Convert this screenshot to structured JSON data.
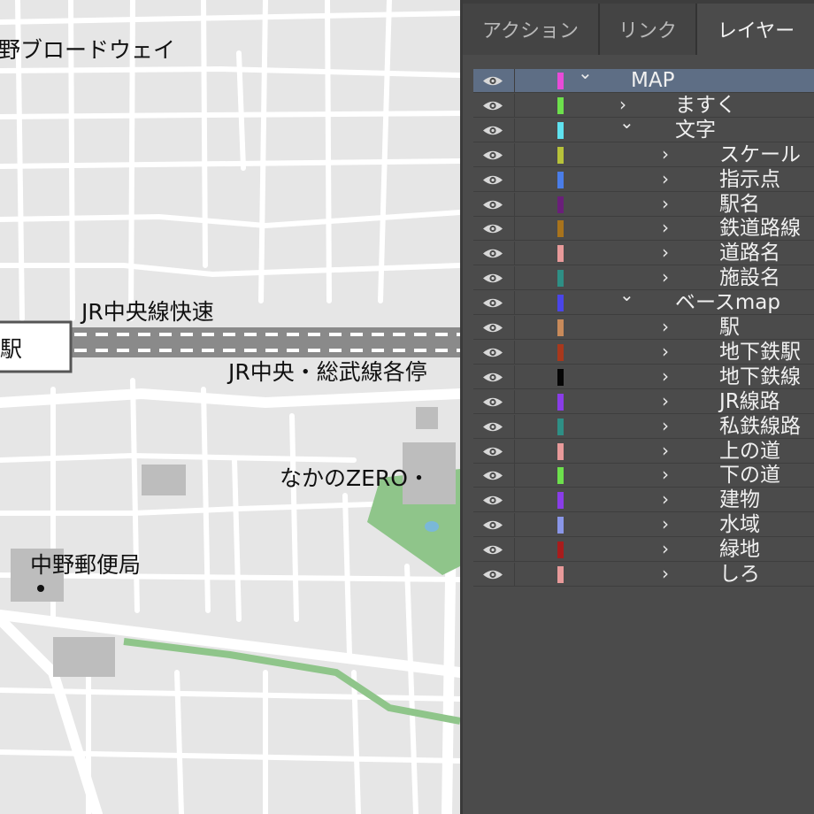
{
  "map": {
    "labels": {
      "broadway": "野ブロードウェイ",
      "jr_rapid": "JR中央線快速",
      "station": "駅",
      "jr_local": "JR中央・総武線各停",
      "nakano_zero": "なかのZERO・",
      "post_office": "中野郵便局"
    },
    "colors": {
      "road": "#ffffff",
      "block": "#efefef",
      "building": "#bdbdbd",
      "green": "#8fc58a",
      "water": "#7ab8d8",
      "rail_dark": "#7a7a7a"
    }
  },
  "panel": {
    "tabs": [
      {
        "label": "アクション",
        "active": false
      },
      {
        "label": "リンク",
        "active": false
      },
      {
        "label": "レイヤー",
        "active": true
      }
    ],
    "layers": [
      {
        "name": "MAP",
        "color": "#e84bd8",
        "expanded": true,
        "selected": true,
        "depth": 0
      },
      {
        "name": "ますく",
        "color": "#6de04c",
        "expanded": false,
        "depth": 1
      },
      {
        "name": "文字",
        "color": "#5fe2ef",
        "expanded": true,
        "depth": 1
      },
      {
        "name": "スケール",
        "color": "#b7c23a",
        "expanded": false,
        "depth": 2
      },
      {
        "name": "指示点",
        "color": "#4a7de8",
        "expanded": false,
        "depth": 2
      },
      {
        "name": "駅名",
        "color": "#6a1f7a",
        "expanded": false,
        "depth": 2
      },
      {
        "name": "鉄道路線",
        "color": "#a8731c",
        "expanded": false,
        "depth": 2
      },
      {
        "name": "道路名",
        "color": "#e89a9a",
        "expanded": false,
        "depth": 2
      },
      {
        "name": "施設名",
        "color": "#2e8f85",
        "expanded": false,
        "depth": 2
      },
      {
        "name": "ベースmap",
        "color": "#4a45e8",
        "expanded": true,
        "depth": 1
      },
      {
        "name": "駅",
        "color": "#c88a5a",
        "expanded": false,
        "depth": 2
      },
      {
        "name": "地下鉄駅",
        "color": "#a8381c",
        "expanded": false,
        "depth": 2
      },
      {
        "name": "地下鉄線",
        "color": "#050505",
        "expanded": false,
        "depth": 2
      },
      {
        "name": "JR線路",
        "color": "#8a3de8",
        "expanded": false,
        "depth": 2
      },
      {
        "name": "私鉄線路",
        "color": "#2e8f85",
        "expanded": false,
        "depth": 2
      },
      {
        "name": "上の道",
        "color": "#e89a9a",
        "expanded": false,
        "depth": 2
      },
      {
        "name": "下の道",
        "color": "#6de04c",
        "expanded": false,
        "depth": 2
      },
      {
        "name": "建物",
        "color": "#8a3de8",
        "expanded": false,
        "depth": 2
      },
      {
        "name": "水域",
        "color": "#8a96e8",
        "expanded": false,
        "depth": 2
      },
      {
        "name": "緑地",
        "color": "#a81c1c",
        "expanded": false,
        "depth": 2
      },
      {
        "name": "しろ",
        "color": "#e89a9a",
        "expanded": false,
        "depth": 2
      }
    ]
  }
}
